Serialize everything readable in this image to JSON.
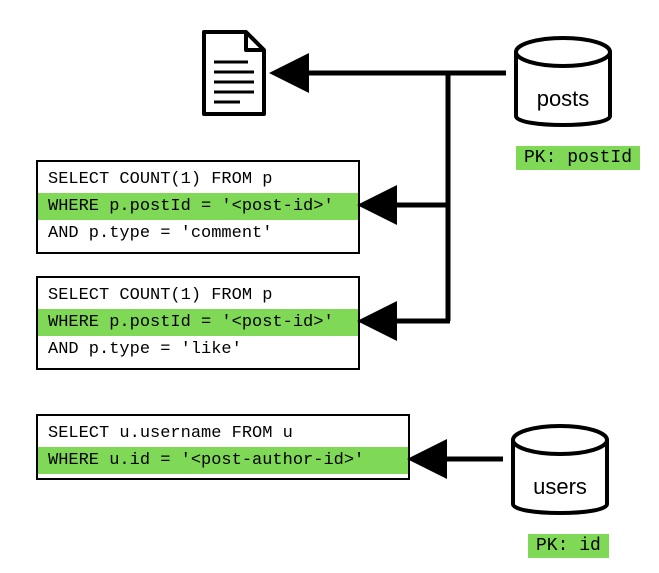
{
  "queries": {
    "q1": {
      "line1": "SELECT COUNT(1) FROM p",
      "line2": "WHERE p.postId = '<post-id>'",
      "line3": "AND p.type = 'comment'"
    },
    "q2": {
      "line1": "SELECT COUNT(1) FROM p",
      "line2": "WHERE p.postId = '<post-id>'",
      "line3": "AND p.type = 'like'"
    },
    "q3": {
      "line1": "SELECT u.username FROM u",
      "line2": "WHERE u.id = '<post-author-id>'"
    }
  },
  "databases": {
    "posts": {
      "label": "posts",
      "pk": "PK: postId"
    },
    "users": {
      "label": "users",
      "pk": "PK: id"
    }
  },
  "icons": {
    "document": "document-icon",
    "cylinder": "database-icon"
  }
}
